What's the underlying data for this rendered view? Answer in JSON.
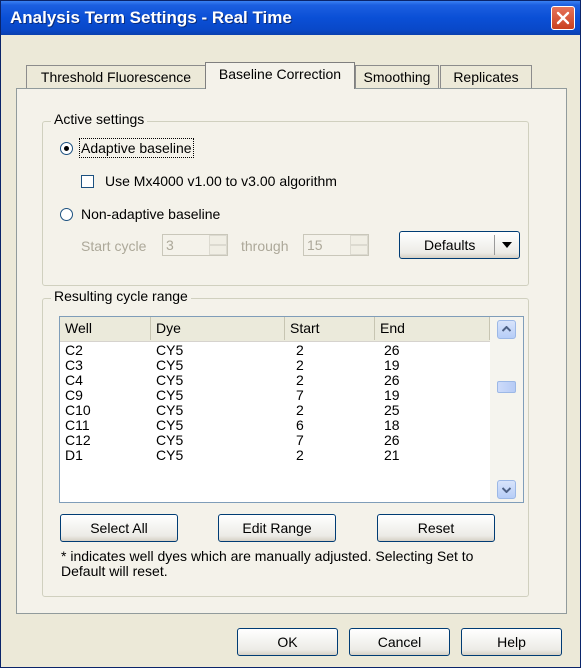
{
  "window": {
    "title": "Analysis Term Settings - Real Time"
  },
  "tabs": [
    {
      "label": "Threshold Fluorescence"
    },
    {
      "label": "Baseline Correction"
    },
    {
      "label": "Smoothing"
    },
    {
      "label": "Replicates"
    }
  ],
  "active_tab": "Baseline Correction",
  "active_settings": {
    "group_label": "Active settings",
    "adaptive_label": "Adaptive baseline",
    "adaptive_selected": true,
    "mx4000_label": "Use Mx4000 v1.00 to v3.00 algorithm",
    "mx4000_checked": false,
    "nonadaptive_label": "Non-adaptive baseline",
    "start_cycle_label": "Start cycle",
    "start_cycle_value": "3",
    "through_label": "through",
    "through_value": "15",
    "defaults_label": "Defaults"
  },
  "resulting_range": {
    "group_label": "Resulting cycle range",
    "columns": [
      "Well",
      "Dye",
      "Start",
      "End"
    ],
    "rows": [
      [
        "C2",
        "CY5",
        "2",
        "26"
      ],
      [
        "C3",
        "CY5",
        "2",
        "19"
      ],
      [
        "C4",
        "CY5",
        "2",
        "26"
      ],
      [
        "C9",
        "CY5",
        "7",
        "19"
      ],
      [
        "C10",
        "CY5",
        "2",
        "25"
      ],
      [
        "C11",
        "CY5",
        "6",
        "18"
      ],
      [
        "C12",
        "CY5",
        "7",
        "26"
      ],
      [
        "D1",
        "CY5",
        "2",
        "21"
      ]
    ],
    "select_all_label": "Select All",
    "edit_range_label": "Edit Range",
    "reset_label": "Reset",
    "note": "* indicates well dyes which are manually adjusted. Selecting Set to Default will reset."
  },
  "footer": {
    "ok_label": "OK",
    "cancel_label": "Cancel",
    "help_label": "Help"
  }
}
